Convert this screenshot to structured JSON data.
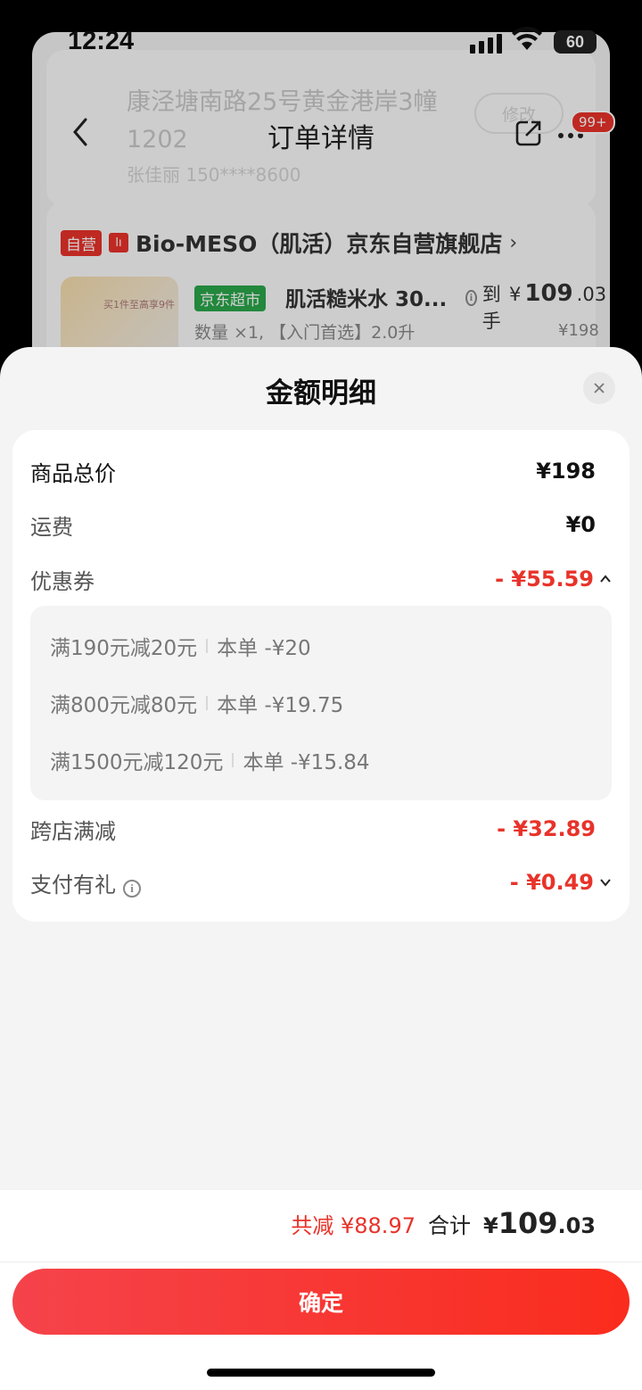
{
  "status_bar": {
    "time": "12:24",
    "battery": "60"
  },
  "background": {
    "address": "康泾塘南路25号黄金港岸3幢1202",
    "contact": "张佳丽  150****8600",
    "modify_label": "修改",
    "nav": {
      "title": "订单详情",
      "badge": "99+"
    },
    "store": {
      "self_tag": "自营",
      "logo_text": "lı",
      "name": "Bio-MESO（肌活）京东自营旗舰店",
      "chevron": "›"
    },
    "product": {
      "thumb_text": "买1件至高享9件",
      "market_tag": "京东超市",
      "name": "肌活糙米水 30...",
      "price_prefix": "到手",
      "price_currency": "¥",
      "price_int": "109",
      "price_dec": ".03",
      "quantity": "数量 ×1, 【入门首选】2.0升",
      "original_price": "¥198"
    }
  },
  "sheet": {
    "title": "金额明细",
    "rows": [
      {
        "label": "商品总价",
        "value": "¥198"
      },
      {
        "label": "运费",
        "value": "¥0"
      },
      {
        "label": "优惠券",
        "value": "- ¥55.59"
      },
      {
        "label": "跨店满减",
        "value": "- ¥32.89"
      },
      {
        "label": "支付有礼",
        "value": "- ¥0.49"
      }
    ],
    "coupons": [
      {
        "rule": "满190元减20元",
        "amount": "本单 -¥20"
      },
      {
        "rule": "满800元减80元",
        "amount": "本单 -¥19.75"
      },
      {
        "rule": "满1500元减120元",
        "amount": "本单 -¥15.84"
      }
    ]
  },
  "footer": {
    "saved": "共减 ¥88.97",
    "total_label": "合计",
    "total_currency": "¥",
    "total_int": "109",
    "total_dec": ".03",
    "confirm_label": "确定"
  },
  "colors": {
    "accent_red": "#e8332a",
    "market_green": "#2aa74a"
  }
}
